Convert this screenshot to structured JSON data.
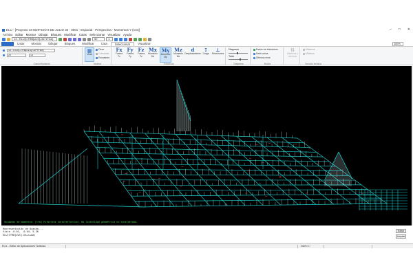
{
  "window": {
    "title": "ELU - [Proyecto 40 EDIFICIO 8 DE JULIO 33 - 0001 - Espacial - Perspectiva - Momentos Y (CG)]",
    "controls": [
      "–",
      "□",
      "✕"
    ]
  },
  "menubar": {
    "items": [
      "Archivo",
      "Editar",
      "Mostrar",
      "Dibujar",
      "Bloques",
      "Modificar",
      "Cotas",
      "Seleccionar",
      "Visualizar",
      "Ayuda"
    ]
  },
  "quickbar": {
    "view_combo": "13 - ELU(CTRB[ULS]-Gk+s+Ad)",
    "scale_combo": "50",
    "unit_combo": "1"
  },
  "ribbon": {
    "tabs": [
      "",
      "Listar",
      "Mostrar",
      "Dibujar",
      "Bloques",
      "Modificar",
      "Cota",
      "Seleccionar",
      "Visualizar"
    ],
    "active_tab": "Seleccionar",
    "combo_case": "13 - ELU(CTRB[ULS]-Gk+s+Ad)",
    "combo_a": "20",
    "combo_b": "13",
    "groups": {
      "cases": "Casos/Hipótesis",
      "display": "Mostrar",
      "forces": "Esfuerzos",
      "diagram": "Diagrama",
      "nodes": "Nodos",
      "section": "Sección térmica"
    },
    "view_button": "Vista",
    "checks": [
      "Flexo",
      "Columnas",
      "Escuadras"
    ],
    "force_buttons": [
      {
        "icon": "Fx",
        "label": "Fuerza Fx"
      },
      {
        "icon": "Fy",
        "label": "Fuerza Fy"
      },
      {
        "icon": "Fz",
        "label": "Fuerza Fz"
      },
      {
        "icon": "Mx",
        "label": "Momento Mx"
      },
      {
        "icon": "My",
        "label": "Momento My"
      },
      {
        "icon": "Mz",
        "label": "Momento Mz"
      },
      {
        "icon": "d",
        "label": "Desplazamiento"
      },
      {
        "icon": "↧",
        "label": "Carga"
      },
      {
        "icon": "⊥",
        "label": "Reacciones"
      }
    ],
    "diagram_labels": [
      "Diagrama",
      "Texto"
    ],
    "node_rows": [
      "Dados los elementos",
      "Debe cerca",
      "Últimos cerca"
    ],
    "disabled_buttons": [
      "Máximos y mínimos"
    ],
    "section_rows": [
      "Máximos",
      "Mínimos"
    ]
  },
  "zoom": "100%",
  "viewport": {
    "status_line": "Unidades de momentos: [tfm] Esfuerzos característicos. No linealidad geométrica no considerada."
  },
  "console": {
    "lines": [
      "Representación de Quando...",
      "Vista      -0.01,  -0.04,    5.36",
      "ELU(CTRB[ULS]-Gk+s+Ad)"
    ],
    "buttons": [
      "Editar",
      "Limpiar"
    ]
  },
  "statusbar": {
    "app_text": "ELU - Editor de Aplicaciones Gráficas",
    "level": "Nivel 0 /"
  },
  "colors": {
    "accent": "#2b6cc4",
    "mesh": "#19c7c7",
    "diagram": "#d8f0f0",
    "annotation": "#ff4a4a",
    "background": "#000000"
  }
}
